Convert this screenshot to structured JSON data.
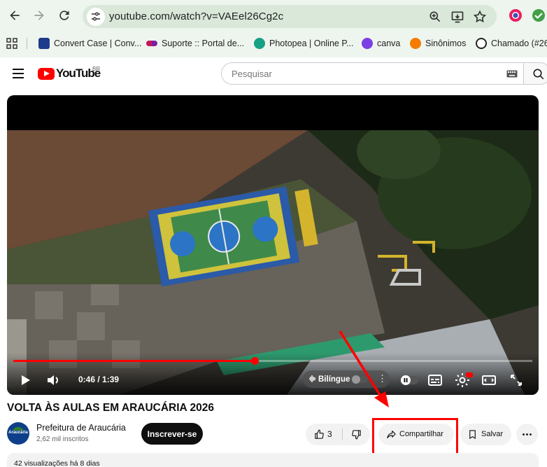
{
  "browser": {
    "url": "youtube.com/watch?v=VAEel26Cg2c",
    "bookmarks": [
      {
        "label": "Convert Case | Conv...",
        "color": "#1e3a8a"
      },
      {
        "label": "Suporte :: Portal de...",
        "color": "#c2185b"
      },
      {
        "label": "Photopea | Online P...",
        "color": "#16a085"
      },
      {
        "label": "canva",
        "color": "#7b3fe4"
      },
      {
        "label": "Sinônimos",
        "color": "#f57c00"
      },
      {
        "label": "Chamado (#26",
        "color": "#222222"
      }
    ]
  },
  "youtube": {
    "logo_word": "YouTube",
    "country": "BR",
    "search_placeholder": "Pesquisar"
  },
  "player": {
    "time": "0:46 / 1:39",
    "progress_fraction": 0.4646,
    "bilingue_label": "Bilíngue"
  },
  "video": {
    "title": "VOLTA ÀS AULAS EM ARAUCÁRIA 2026",
    "channel_name": "Prefeitura de Araucária",
    "channel_avatar_text": "Araucária",
    "subscribers": "2,62 mil inscritos",
    "subscribe_label": "Inscrever-se",
    "likes": "3",
    "share_label": "Compartilhar",
    "save_label": "Salvar",
    "meta": "42 visualizações  há 8 dias"
  },
  "colors": {
    "accent_red": "#ff0000",
    "annotation_red": "#ff0000",
    "browser_chrome": "#eef5ee"
  }
}
